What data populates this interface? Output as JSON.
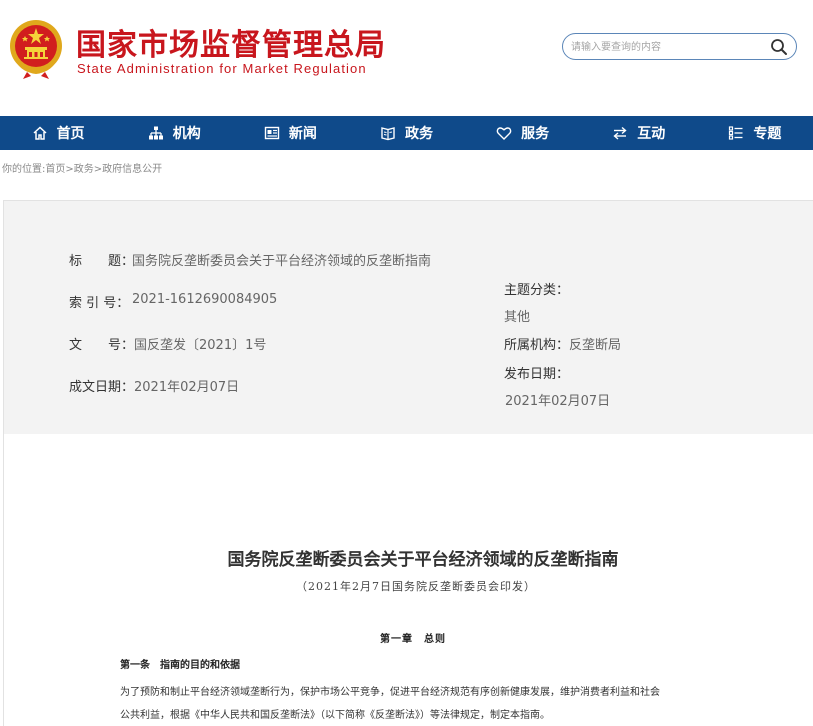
{
  "header": {
    "title_cn": "国家市场监督管理总局",
    "title_en": "State Administration for Market Regulation",
    "emblem_icon": "national-emblem-icon",
    "brand_color": "#c8161d"
  },
  "search": {
    "placeholder": "请输入要查询的内容",
    "icon": "search-icon"
  },
  "nav": {
    "background": "#0f4a8a",
    "items": [
      {
        "label": "首页",
        "icon": "home-icon"
      },
      {
        "label": "机构",
        "icon": "org-chart-icon"
      },
      {
        "label": "新闻",
        "icon": "newspaper-icon"
      },
      {
        "label": "政务",
        "icon": "government-affairs-icon"
      },
      {
        "label": "服务",
        "icon": "heart-icon"
      },
      {
        "label": "互动",
        "icon": "exchange-arrows-icon"
      },
      {
        "label": "专题",
        "icon": "topic-list-icon"
      }
    ]
  },
  "breadcrumb": {
    "prefix": "你的位置:",
    "items": [
      "首页",
      "政务",
      "政府信息公开"
    ],
    "separator": ">"
  },
  "meta": {
    "title_label": "标　　题：",
    "title_value": "国务院反垄断委员会关于平台经济领域的反垄断指南",
    "index_label": "索 引 号：",
    "index_value": "2021-1612690084905",
    "docno_label": "文　　号：",
    "docno_value": "国反垄发〔2021〕1号",
    "written_label": "成文日期：",
    "written_value": "2021年02月07日",
    "topic_label": "主题分类：",
    "topic_value": "其他",
    "org_label": "所属机构：",
    "org_value": "反垄断局",
    "publish_label": "发布日期：",
    "publish_value": "2021年02月07日"
  },
  "document": {
    "title": "国务院反垄断委员会关于平台经济领域的反垄断指南",
    "subtitle": "（2021年2月7日国务院反垄断委员会印发）",
    "chapter": "第一章　总则",
    "article_heading": "第一条　指南的目的和依据",
    "paragraph_line1": "为了预防和制止平台经济领域垄断行为，保护市场公平竞争，促进平台经济规范有序创新健康发展，维护消费者利益和社会",
    "paragraph_line2": "公共利益，根据《中华人民共和国反垄断法》（以下简称《反垄断法》）等法律规定，制定本指南。"
  }
}
